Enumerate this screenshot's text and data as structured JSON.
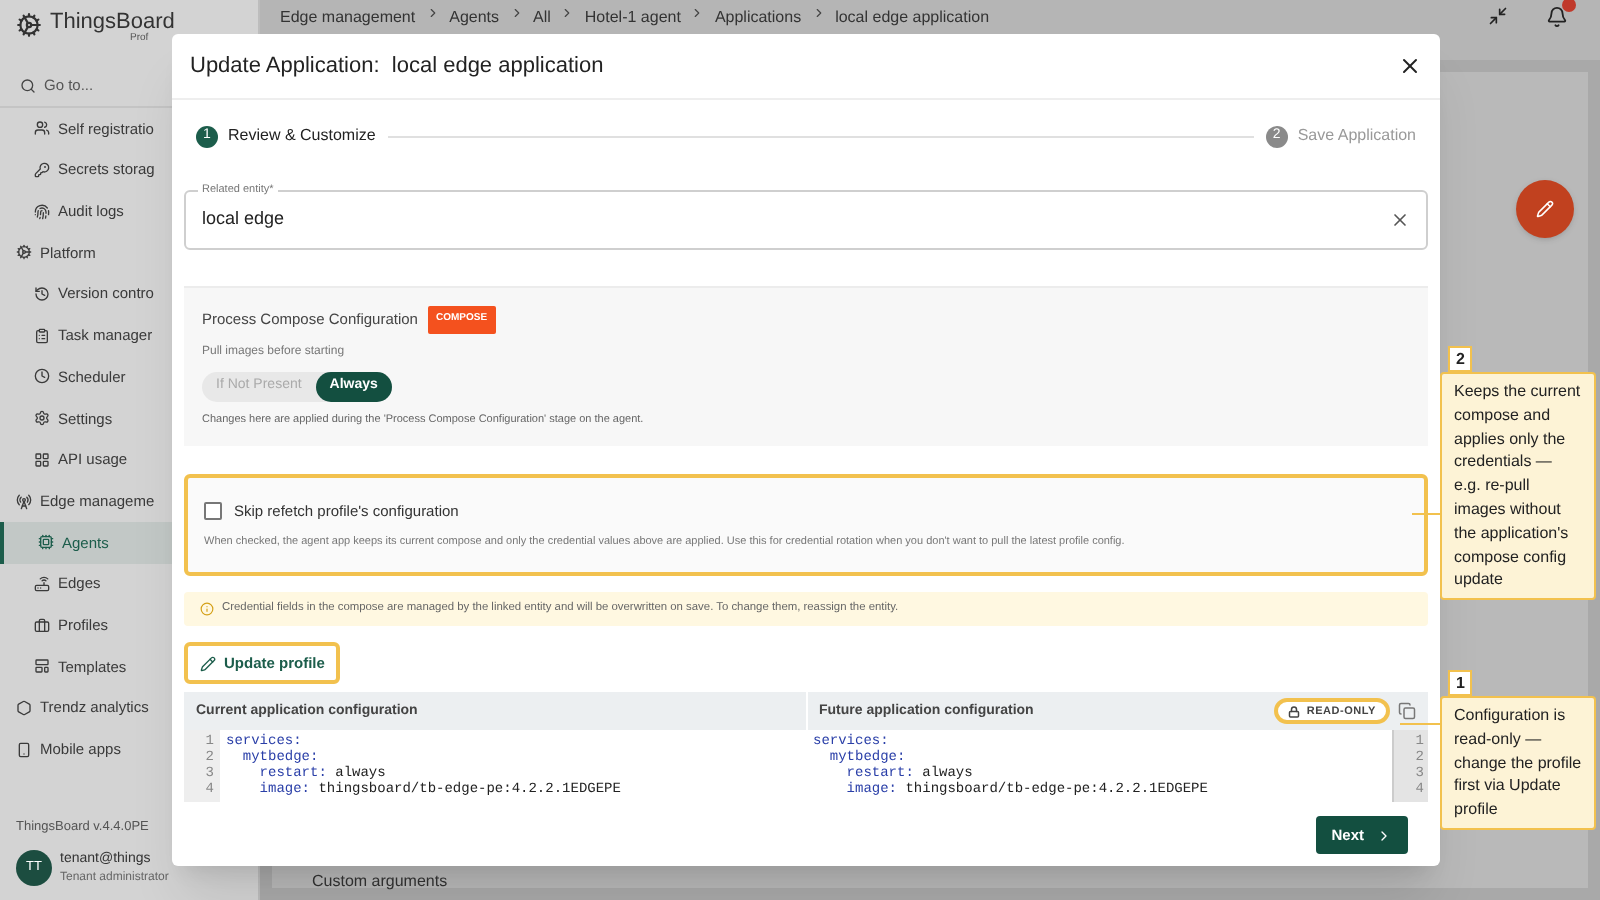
{
  "app": {
    "brand": "ThingsBoard",
    "brand_sub": "Prof",
    "search_placeholder": "Go to...",
    "version": "ThingsBoard v.4.4.0PE",
    "user": {
      "initials": "TT",
      "email": "tenant@things",
      "role": "Tenant administrator"
    }
  },
  "sidebar": {
    "items": [
      {
        "label": "Self registratio",
        "kind": "item",
        "selected": false
      },
      {
        "label": "Secrets storag",
        "kind": "item",
        "selected": false
      },
      {
        "label": "Audit logs",
        "kind": "item",
        "selected": false
      },
      {
        "label": "Platform",
        "kind": "section",
        "selected": false
      },
      {
        "label": "Version contro",
        "kind": "item",
        "selected": false
      },
      {
        "label": "Task manager",
        "kind": "item",
        "selected": false
      },
      {
        "label": "Scheduler",
        "kind": "item",
        "selected": false
      },
      {
        "label": "Settings",
        "kind": "item",
        "selected": false
      },
      {
        "label": "API usage",
        "kind": "item",
        "selected": false
      },
      {
        "label": "Edge manageme",
        "kind": "section",
        "selected": false
      },
      {
        "label": "Agents",
        "kind": "item",
        "selected": true
      },
      {
        "label": "Edges",
        "kind": "item",
        "selected": false
      },
      {
        "label": "Profiles",
        "kind": "item",
        "selected": false
      },
      {
        "label": "Templates",
        "kind": "item",
        "selected": false
      },
      {
        "label": "Trendz analytics",
        "kind": "section",
        "selected": false
      },
      {
        "label": "Mobile apps",
        "kind": "section",
        "selected": false
      }
    ]
  },
  "breadcrumb": [
    "Edge management",
    "Agents",
    "All",
    "Hotel-1 agent",
    "Applications",
    "local edge application"
  ],
  "background": {
    "section_title": "Custom arguments"
  },
  "dialog": {
    "title": "Update Application:  local edge application",
    "steps": [
      {
        "number": "1",
        "label": "Review & Customize",
        "selected": true
      },
      {
        "number": "2",
        "label": "Save Application",
        "selected": false
      }
    ],
    "related_entity": {
      "label": "Related entity*",
      "value": "local edge"
    },
    "compose": {
      "title": "Process Compose Configuration",
      "badge": "COMPOSE",
      "pull_label": "Pull images before starting",
      "options": [
        {
          "label": "If Not Present",
          "selected": false
        },
        {
          "label": "Always",
          "selected": true
        }
      ],
      "note": "Changes here are applied during the 'Process Compose Configuration' stage on the agent."
    },
    "skip_refetch": {
      "label": "Skip refetch profile's configuration",
      "checked": false,
      "highlighted": true,
      "description": "When checked, the agent app keeps its current compose and only the credential values above are applied. Use this for credential rotation when you don't want to pull the latest profile config."
    },
    "warning": "Credential fields in the compose are managed by the linked entity and will be overwritten on save. To change them, reassign the entity.",
    "update_button": {
      "label": "Update profile",
      "highlighted": true
    },
    "editors": [
      {
        "title": "Current application configuration",
        "line_numbers_right": false,
        "lines": [
          {
            "number": "1",
            "code": "services:"
          },
          {
            "number": "2",
            "code": "  mytbedge:"
          },
          {
            "number": "3",
            "code": "    restart: always"
          },
          {
            "number": "4",
            "code": "    image: thingsboard/tb-edge-pe:4.2.2.1EDGEPE"
          }
        ]
      },
      {
        "title": "Future application configuration",
        "line_numbers_right": true,
        "badge": {
          "label": "READ-ONLY",
          "highlighted": true
        },
        "lines": [
          {
            "number": "1",
            "code": "services:"
          },
          {
            "number": "2",
            "code": "  mytbedge:"
          },
          {
            "number": "3",
            "code": "    restart: always"
          },
          {
            "number": "4",
            "code": "    image: thingsboard/tb-edge-pe:4.2.2.1EDGEPE"
          }
        ]
      }
    ],
    "next_button": "Next"
  },
  "callouts": [
    {
      "number": "2",
      "text": "Keeps the current compose and applies only the credentials — e.g. re-pull images without the application's compose config update"
    },
    {
      "number": "1",
      "text": "Configuration is read-only — change the profile first via Update profile"
    }
  ]
}
